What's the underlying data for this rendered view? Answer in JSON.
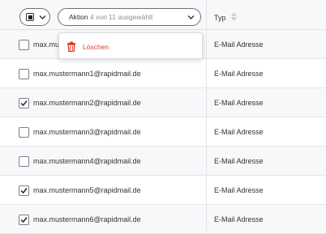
{
  "header": {
    "action_label": "Aktion",
    "action_count": "4 von 11 ausgewählt",
    "type_column": "Typ"
  },
  "dropdown": {
    "delete_label": "Löschen"
  },
  "rows": [
    {
      "email": "max.mustermann@rapidmail.de",
      "type": "E-Mail Adresse",
      "checked": false
    },
    {
      "email": "max.mustermann1@rapidmail.de",
      "type": "E-Mail Adresse",
      "checked": false
    },
    {
      "email": "max.mustermann2@rapidmail.de",
      "type": "E-Mail Adresse",
      "checked": true
    },
    {
      "email": "max.mustermann3@rapidmail.de",
      "type": "E-Mail Adresse",
      "checked": false
    },
    {
      "email": "max.mustermann4@rapidmail.de",
      "type": "E-Mail Adresse",
      "checked": false
    },
    {
      "email": "max.mustermann5@rapidmail.de",
      "type": "E-Mail Adresse",
      "checked": true
    },
    {
      "email": "max.mustermann6@rapidmail.de",
      "type": "E-Mail Adresse",
      "checked": true
    }
  ],
  "colors": {
    "delete": "#e03c2c",
    "row_alt": "#f7f8f9",
    "border": "#e3e5e8"
  }
}
